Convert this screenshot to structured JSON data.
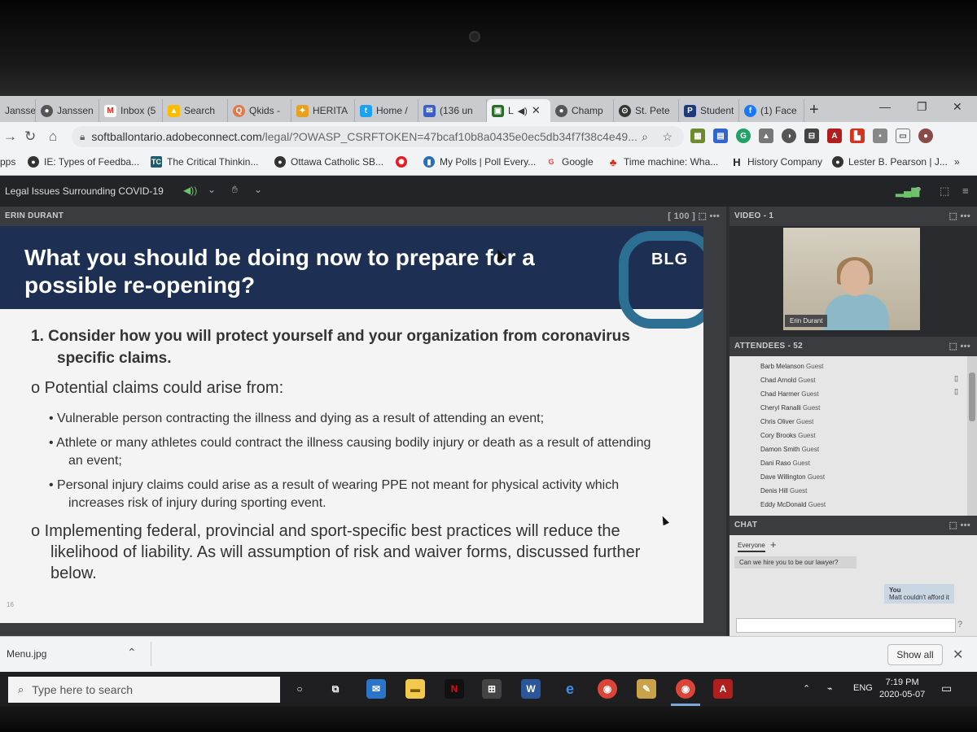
{
  "browser": {
    "tabs": [
      {
        "label": "Janssen",
        "icon": "J"
      },
      {
        "label": "Janssen",
        "icon": "J"
      },
      {
        "label": "Inbox (5",
        "icon": "M"
      },
      {
        "label": "Search",
        "icon": "drive"
      },
      {
        "label": "Qkids -",
        "icon": "Q"
      },
      {
        "label": "HERITA",
        "icon": "H"
      },
      {
        "label": "Home /",
        "icon": "twitter"
      },
      {
        "label": "(136 un",
        "icon": "mail"
      },
      {
        "label": "L",
        "icon": "adobe-connect"
      },
      {
        "label": "Champ",
        "icon": "C"
      },
      {
        "label": "St. Pete",
        "icon": "S"
      },
      {
        "label": "Student",
        "icon": "P"
      },
      {
        "label": "(1) Face",
        "icon": "f"
      }
    ],
    "url_main": "softballontario.adobeconnect.com",
    "url_rest": "/legal/?OWASP_CSRFTOKEN=47bcaf10b8a0435e0ec5db34f7f38c4e49...",
    "bookmarks": [
      {
        "label": "pps",
        "icon": "apps"
      },
      {
        "label": "IE: Types of Feedba...",
        "icon": "globe"
      },
      {
        "label": "The Critical Thinkin...",
        "icon": "TC"
      },
      {
        "label": "Ottawa Catholic SB...",
        "icon": "globe"
      },
      {
        "label": "",
        "icon": "cbc"
      },
      {
        "label": "My Polls | Poll Every...",
        "icon": "poll"
      },
      {
        "label": "Google",
        "icon": "G"
      },
      {
        "label": "Time machine: Wha...",
        "icon": "maple-leaf"
      },
      {
        "label": "History Company",
        "icon": "H"
      },
      {
        "label": "Lester B. Pearson | J...",
        "icon": "globe"
      },
      {
        "label": "»",
        "icon": ""
      }
    ]
  },
  "meeting": {
    "title": "Legal Issues Surrounding COVID-19",
    "share_pod_title": "ERIN DURANT",
    "video_pod_title": "VIDEO - 1",
    "attendees_pod_title": "ATTENDEES - 52",
    "chat_pod_title": "CHAT",
    "presenter_name": "Erin Durant"
  },
  "slide": {
    "title": "What you should be doing now to prepare for a possible re-opening?",
    "logo": "BLG",
    "point1": "1.  Consider how you will protect yourself and your organization from coronavirus specific claims.",
    "bullet1": "o  Potential claims could arise from:",
    "sub1": "•   Vulnerable person contracting the illness and dying as a result of attending an event;",
    "sub2": "•   Athlete or many athletes could contract the illness causing bodily injury or death as a result of attending an event;",
    "sub3": "•   Personal injury claims could arise as a result of wearing PPE not meant for physical activity which increases risk of injury during sporting event.",
    "bullet2": "o  Implementing federal, provincial and sport-specific best practices will reduce the likelihood of liability. As will assumption of risk and waiver forms, discussed further below.",
    "page_number": "16"
  },
  "attendees": [
    {
      "name": "Barb Melanson",
      "role": "Guest"
    },
    {
      "name": "Chad Arnold",
      "role": "Guest"
    },
    {
      "name": "Chad Harmer",
      "role": "Guest"
    },
    {
      "name": "Cheryl Ranalli",
      "role": "Guest"
    },
    {
      "name": "Chris Oliver",
      "role": "Guest"
    },
    {
      "name": "Cory Brooks",
      "role": "Guest"
    },
    {
      "name": "Damon Smith",
      "role": "Guest"
    },
    {
      "name": "Dani Raso",
      "role": "Guest"
    },
    {
      "name": "Dave Willington",
      "role": "Guest"
    },
    {
      "name": "Denis Hill",
      "role": "Guest"
    },
    {
      "name": "Eddy McDonald",
      "role": "Guest"
    }
  ],
  "chat": {
    "tab": "Everyone",
    "messages": [
      {
        "author": "",
        "text": "Can we hire you to be our lawyer?"
      },
      {
        "author": "You",
        "text": "Matt couldn't afford it"
      }
    ]
  },
  "downloads": {
    "file": "Menu.jpg",
    "show_all": "Show all"
  },
  "taskbar": {
    "search_placeholder": "Type here to search",
    "language": "ENG",
    "time": "7:19 PM",
    "date": "2020-05-07"
  }
}
